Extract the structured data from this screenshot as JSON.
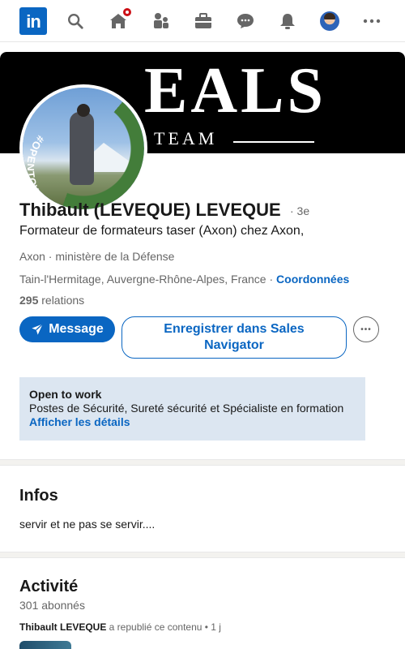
{
  "nav": {
    "logo_text": "in",
    "icons": [
      "search-icon",
      "home-icon",
      "my-network-icon",
      "jobs-icon",
      "messaging-icon",
      "notifications-icon",
      "me-avatar",
      "more-icon"
    ],
    "home_badge": true
  },
  "banner": {
    "big_text": "EALS",
    "small_text": "TEAM"
  },
  "profile": {
    "otw_ring_text": "#OPENTOWORK",
    "name": "Thibault (LEVEQUE) LEVEQUE",
    "degree": "· 3e",
    "headline": "Formateur de formateurs taser (Axon) chez Axon,",
    "company": "Axon · ministère de la Défense",
    "location": "Tain-l'Hermitage, Auvergne-Rhône-Alpes, France · ",
    "coords_link": "Coordonnées",
    "relations_count": "295",
    "relations_label": " relations"
  },
  "actions": {
    "message": "Message",
    "sales_navigator": "Enregistrer dans Sales Navigator",
    "more": "•••"
  },
  "open_to_work": {
    "title": "Open to work",
    "description": "Postes de Sécurité, Sureté sécurité et Spécialiste en formation",
    "link": "Afficher les détails"
  },
  "infos": {
    "title": "Infos",
    "text": "servir et ne pas se servir...."
  },
  "activity": {
    "title": "Activité",
    "followers": "301 abonnés",
    "repost_author": "Thibault LEVEQUE",
    "repost_text": " a republié ce contenu • 1 j"
  },
  "colors": {
    "brand": "#0a66c2",
    "open_to_work_green": "#437d3a",
    "badge_red": "#cc1016",
    "otw_box_bg": "#dce6f1"
  }
}
